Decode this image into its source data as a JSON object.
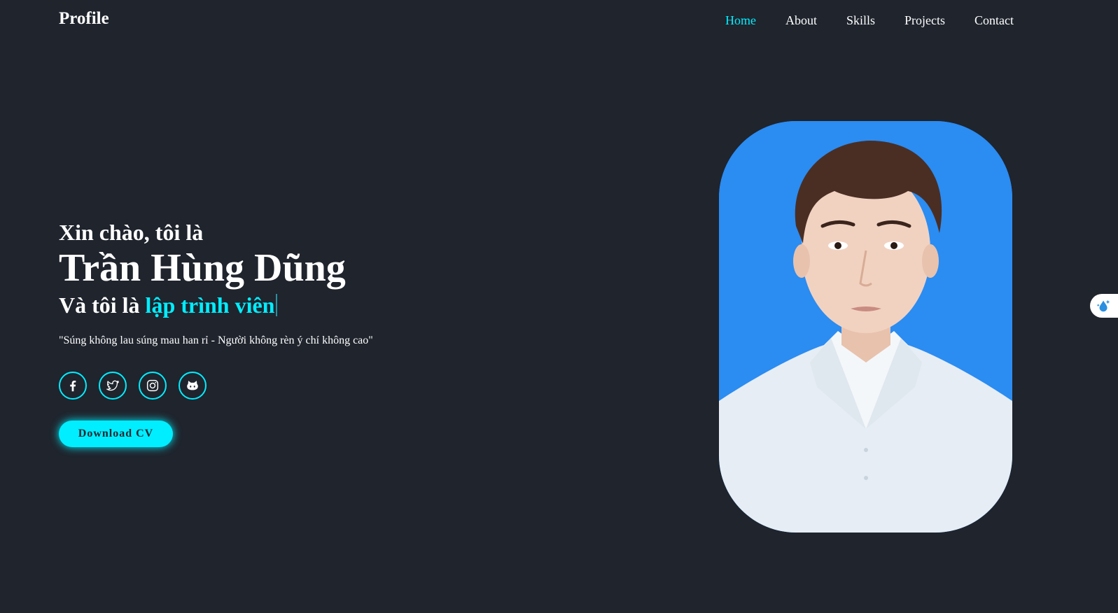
{
  "header": {
    "logo": "Profile",
    "nav": [
      {
        "label": "Home",
        "active": true
      },
      {
        "label": "About",
        "active": false
      },
      {
        "label": "Skills",
        "active": false
      },
      {
        "label": "Projects",
        "active": false
      },
      {
        "label": "Contact",
        "active": false
      }
    ]
  },
  "hero": {
    "greeting": "Xin chào, tôi là",
    "name": "Trần Hùng Dũng",
    "role_prefix": "Và tôi là",
    "role_highlight": "lập trình viên",
    "quote": "\"Súng không lau súng mau han rỉ - Người không rèn ý chí không cao\"",
    "cv_button": "Download CV"
  },
  "socials": [
    {
      "icon": "facebook-icon"
    },
    {
      "icon": "twitter-icon"
    },
    {
      "icon": "instagram-icon"
    },
    {
      "icon": "github-icon"
    }
  ],
  "portrait": {
    "icon": "profile-photo"
  },
  "extension": {
    "icon": "water-drop-sparkle-icon"
  },
  "colors": {
    "background": "#1f242d",
    "accent": "#00eeff",
    "text": "#ffffff",
    "photo_background": "#2b8cf2"
  }
}
